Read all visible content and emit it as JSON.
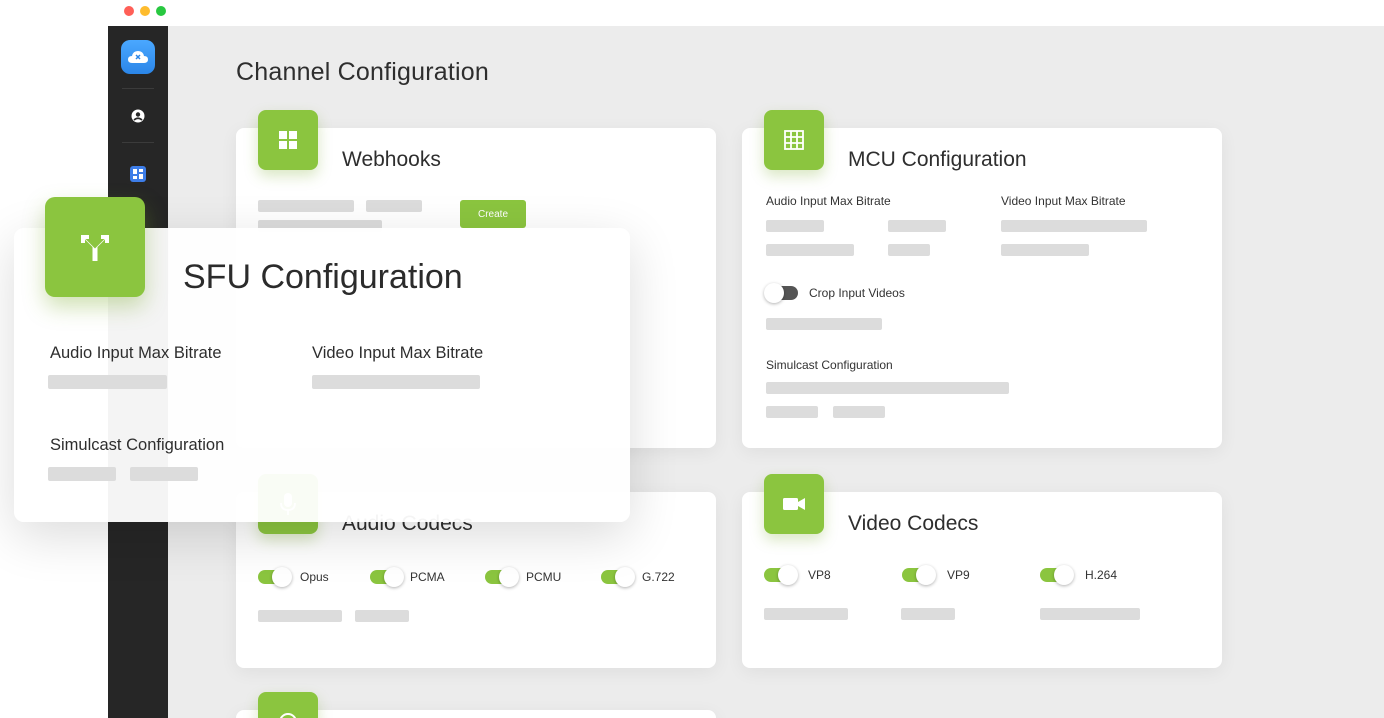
{
  "page": {
    "title": "Channel Configuration"
  },
  "sidebar": {
    "items": [
      {
        "icon": "cloud-logo-icon"
      },
      {
        "icon": "user-icon"
      },
      {
        "icon": "dashboard-icon",
        "active": true
      }
    ]
  },
  "webhooks": {
    "title": "Webhooks",
    "create_label": "Create"
  },
  "mcu": {
    "title": "MCU Configuration",
    "audio_label": "Audio Input Max Bitrate",
    "video_label": "Video Input Max Bitrate",
    "crop_label": "Crop Input Videos",
    "crop_enabled": false,
    "simulcast_label": "Simulcast Configuration"
  },
  "audio_codecs": {
    "title": "Audio Codecs",
    "codecs": [
      {
        "label": "Opus",
        "enabled": true
      },
      {
        "label": "PCMA",
        "enabled": true
      },
      {
        "label": "PCMU",
        "enabled": true
      },
      {
        "label": "G.722",
        "enabled": true
      }
    ]
  },
  "video_codecs": {
    "title": "Video Codecs",
    "codecs": [
      {
        "label": "VP8",
        "enabled": true
      },
      {
        "label": "VP9",
        "enabled": true
      },
      {
        "label": "H.264",
        "enabled": true
      }
    ]
  },
  "sfu": {
    "title": "SFU Configuration",
    "audio_label": "Audio Input Max Bitrate",
    "video_label": "Video Input Max Bitrate",
    "simulcast_label": "Simulcast Configuration"
  },
  "colors": {
    "accent": "#8bc53f",
    "sidebar": "#262626",
    "background": "#ececec"
  }
}
